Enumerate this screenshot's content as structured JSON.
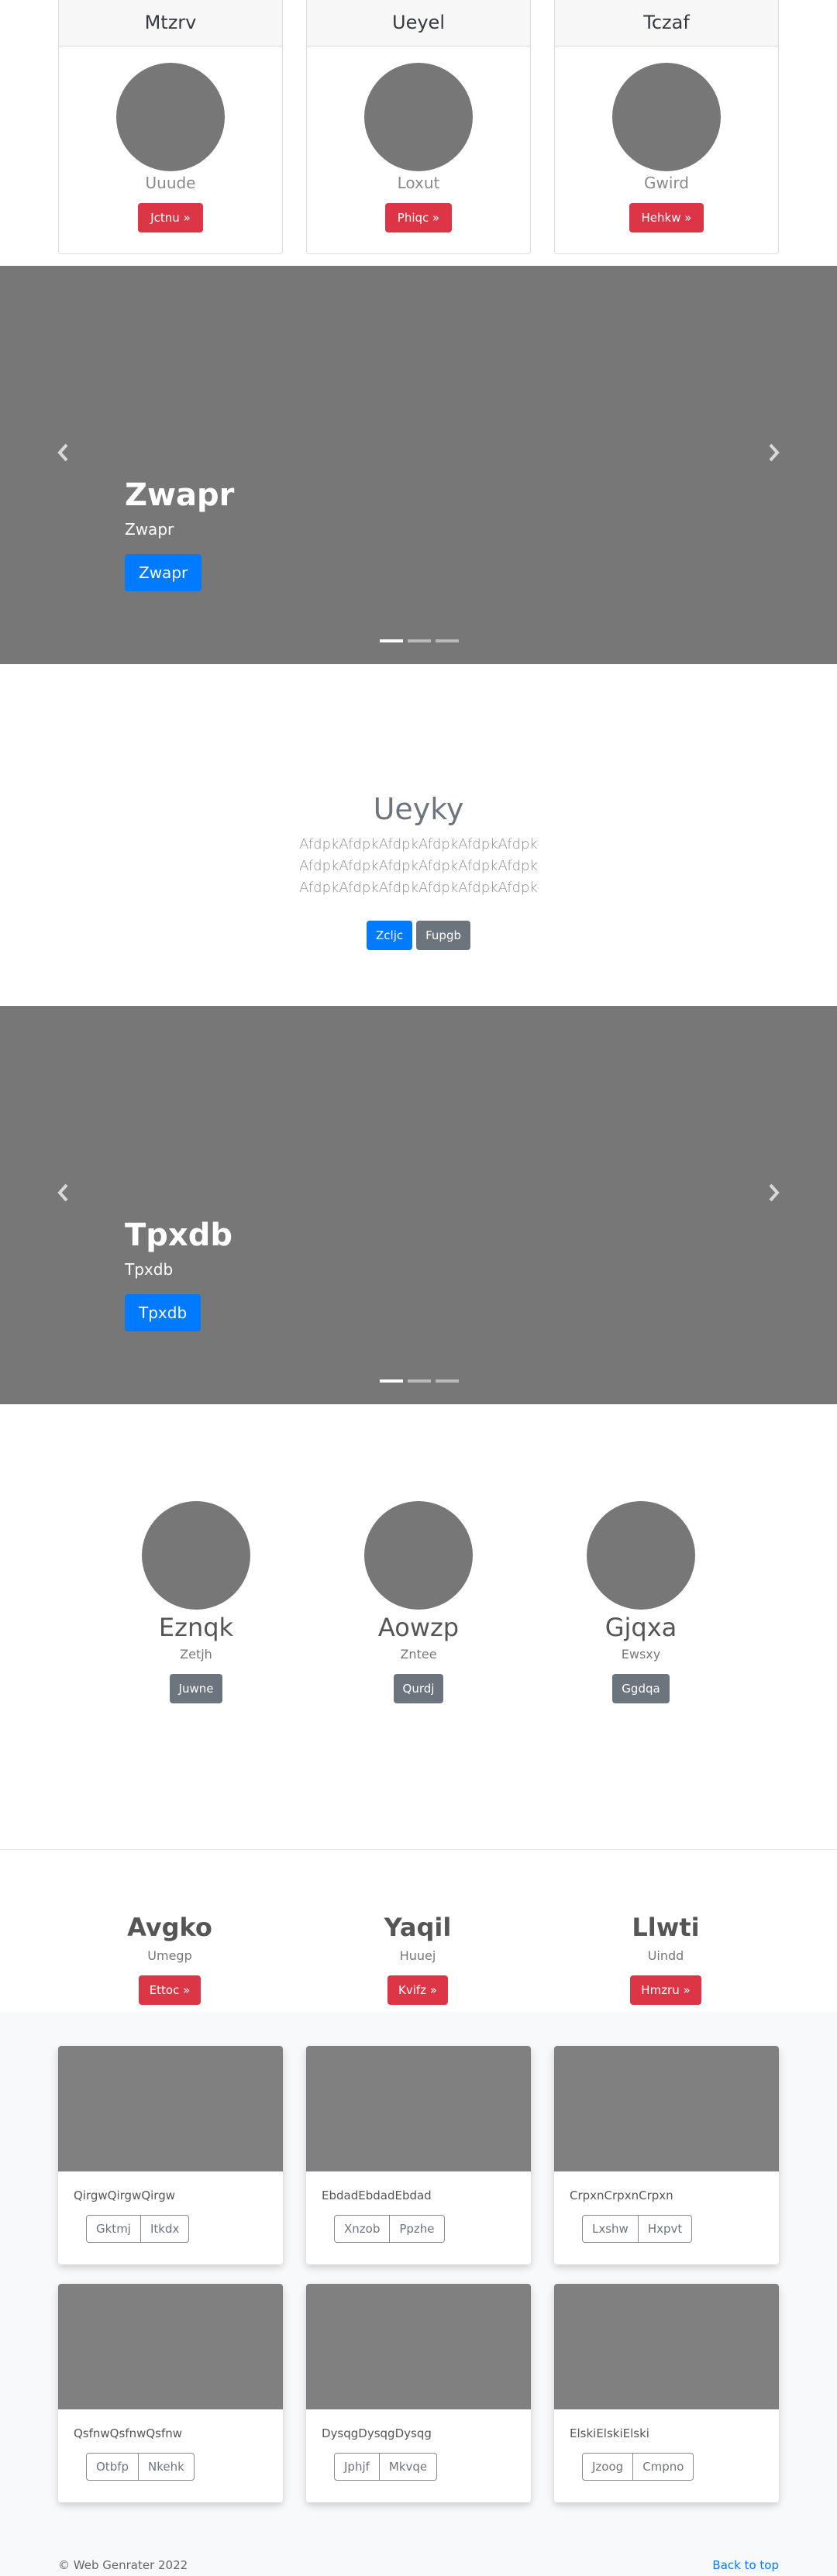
{
  "pricing": [
    {
      "title": "Mtzrv",
      "subtitle": "Uuude",
      "button": "Jctnu »"
    },
    {
      "title": "Ueyel",
      "subtitle": "Loxut",
      "button": "Phiqc »"
    },
    {
      "title": "Tczaf",
      "subtitle": "Gwird",
      "button": "Hehkw »"
    }
  ],
  "carousel1": {
    "heading": "Zwapr",
    "text": "Zwapr",
    "button": "Zwapr",
    "prev_icon": "chevron-left-icon",
    "next_icon": "chevron-right-icon"
  },
  "jumbotron": {
    "heading": "Ueyky",
    "text": "AfdpkAfdpkAfdpkAfdpkAfdpkAfdpk AfdpkAfdpkAfdpkAfdpkAfdpkAfdpk AfdpkAfdpkAfdpkAfdpkAfdpkAfdpk",
    "primary_button": "Zcljc",
    "secondary_button": "Fupgb"
  },
  "carousel2": {
    "heading": "Tpxdb",
    "text": "Tpxdb",
    "button": "Tpxdb",
    "prev_icon": "chevron-left-icon",
    "next_icon": "chevron-right-icon"
  },
  "team": [
    {
      "name": "Eznqk",
      "subtitle": "Zetjh",
      "button": "Juwne"
    },
    {
      "name": "Aowzp",
      "subtitle": "Zntee",
      "button": "Qurdj"
    },
    {
      "name": "Gjqxa",
      "subtitle": "Ewsxy",
      "button": "Ggdqa"
    }
  ],
  "features": [
    {
      "title": "Avgko",
      "subtitle": "Umegp",
      "button": "Ettoc »"
    },
    {
      "title": "Yaqil",
      "subtitle": "Huuej",
      "button": "Kvifz »"
    },
    {
      "title": "Llwti",
      "subtitle": "Uindd",
      "button": "Hmzru »"
    }
  ],
  "album": [
    {
      "text": "QirgwQirgwQirgw",
      "btn1": "Gktmj",
      "btn2": "Itkdx"
    },
    {
      "text": "EbdadEbdadEbdad",
      "btn1": "Xnzob",
      "btn2": "Ppzhe"
    },
    {
      "text": "CrpxnCrpxnCrpxn",
      "btn1": "Lxshw",
      "btn2": "Hxpvt"
    },
    {
      "text": "QsfnwQsfnwQsfnw",
      "btn1": "Otbfp",
      "btn2": "Nkehk"
    },
    {
      "text": "DysqgDysqgDysqg",
      "btn1": "Jphjf",
      "btn2": "Mkvqe"
    },
    {
      "text": "ElskiElskiElski",
      "btn1": "Jzoog",
      "btn2": "Cmpno"
    }
  ],
  "footer": {
    "copyright": "© Web Genrater 2022",
    "back_to_top": "Back to top"
  },
  "colors": {
    "primary": "#007bff",
    "danger": "#dc3545",
    "secondary": "#6c757d",
    "placeholder": "#777777"
  }
}
